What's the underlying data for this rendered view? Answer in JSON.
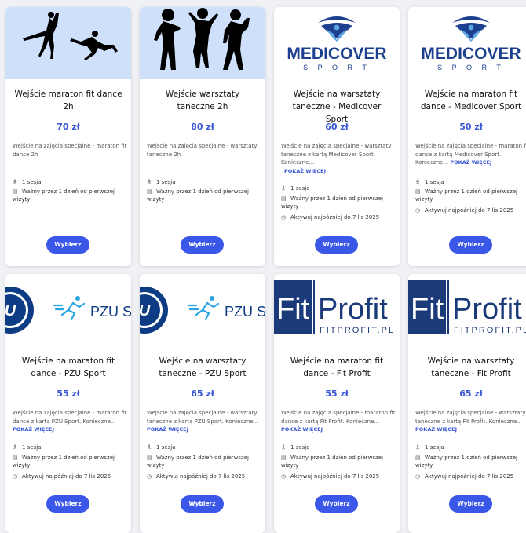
{
  "cards": [
    {
      "title": "Wejście maraton fit dance 2h",
      "price": "70 zł",
      "desc": "Wejście na zajęcia specjalne - maraton fit dance 2h",
      "more": "",
      "sessions": "1 sesja",
      "validity": "Ważny przez 1 dzień od pierwszej wizyty",
      "activate": "",
      "button": "Wybierz",
      "image": "dancers-silhouette"
    },
    {
      "title": "Wejście warsztaty taneczne 2h",
      "price": "80 zł",
      "desc": "Wejście na zajęcia specjalne - warsztaty taneczne 2h",
      "more": "",
      "sessions": "1 sesja",
      "validity": "Ważny przez 1 dzień od pierwszej wizyty",
      "activate": "",
      "button": "Wybierz",
      "image": "disco-dancers-silhouette"
    },
    {
      "title": "Wejście na warsztaty taneczne - Medicover Sport",
      "price": "60 zł",
      "desc": "Wejście na zajęcia specjalne - warsztaty taneczne z kartą Medicover Sport. Konieczne...",
      "more": "POKAŻ WIĘCEJ",
      "sessions": "1 sesja",
      "validity": "Ważny przez 1 dzień od pierwszej wizyty",
      "activate": "Aktywuj najpóźniej do 7 lis 2025",
      "button": "Wybierz",
      "image": "medicover-logo"
    },
    {
      "title": "Wejście na maraton fit dance - Medicover Sport",
      "price": "50 zł",
      "desc": "Wejście na zajęcia specjalne - maraton fit dance z kartą Medicover Sport. Konieczne...",
      "more": "POKAŻ WIĘCEJ",
      "sessions": "1 sesja",
      "validity": "Ważny przez 1 dzień od pierwszej wizyty",
      "activate": "Aktywuj najpóźniej do 7 lis 2025",
      "button": "Wybierz",
      "image": "medicover-logo"
    },
    {
      "title": "Wejście na maraton fit dance - PZU Sport",
      "price": "55 zł",
      "desc": "Wejście na zajęcia specjalne - maraton fit dance z kartą PZU Sport. Konieczne...",
      "more": "POKAŻ WIĘCEJ",
      "sessions": "1 sesja",
      "validity": "Ważny przez 1 dzień od pierwszej wizyty",
      "activate": "Aktywuj najpóźniej do 7 lis 2025",
      "button": "Wybierz",
      "image": "pzu-logo"
    },
    {
      "title": "Wejście na warsztaty taneczne - PZU Sport",
      "price": "65 zł",
      "desc": "Wejście na zajęcia specjalne - warsztaty taneczne z kartą PZU Sport. Konieczne...",
      "more": "POKAŻ WIĘCEJ",
      "sessions": "1 sesja",
      "validity": "Ważny przez 1 dzień od pierwszej wizyty",
      "activate": "Aktywuj najpóźniej do 7 lis 2025",
      "button": "Wybierz",
      "image": "pzu-logo"
    },
    {
      "title": "Wejście na maraton fit dance - Fit Profit",
      "price": "55 zł",
      "desc": "Wejście na zajęcia specjalne - maraton fit dance z kartą Fit Profit. Konieczne...",
      "more": "POKAŻ WIĘCEJ",
      "sessions": "1 sesja",
      "validity": "Ważny przez 1 dzień od pierwszej wizyty",
      "activate": "Aktywuj najpóźniej do 7 lis 2025",
      "button": "Wybierz",
      "image": "fitprofit-logo"
    },
    {
      "title": "Wejście na warsztaty taneczne - Fit Profit",
      "price": "65 zł",
      "desc": "Wejście na zajęcia specjalne - warsztaty taneczne z kartą Fit Profit. Konieczne...",
      "more": "POKAŻ WIĘCEJ",
      "sessions": "1 sesja",
      "validity": "Ważny przez 1 dzień od pierwszej wizyty",
      "activate": "Aktywuj najpóźniej do 7 lis 2025",
      "button": "Wybierz",
      "image": "fitprofit-logo"
    }
  ],
  "logos": {
    "medicover_word": "MEDICOVER",
    "medicover_sub": "S P O R T",
    "pzu_text": "PZU S",
    "fitprofit_fit": "Fit",
    "fitprofit_profit": "Profit",
    "fitprofit_url": "FITPROFIT.PL"
  },
  "colors": {
    "accent": "#3a57e8",
    "price": "#3a57d6",
    "medicover": "#1d3f8f",
    "pzu": "#0d3c85",
    "fitprofit": "#1b3a7a"
  }
}
